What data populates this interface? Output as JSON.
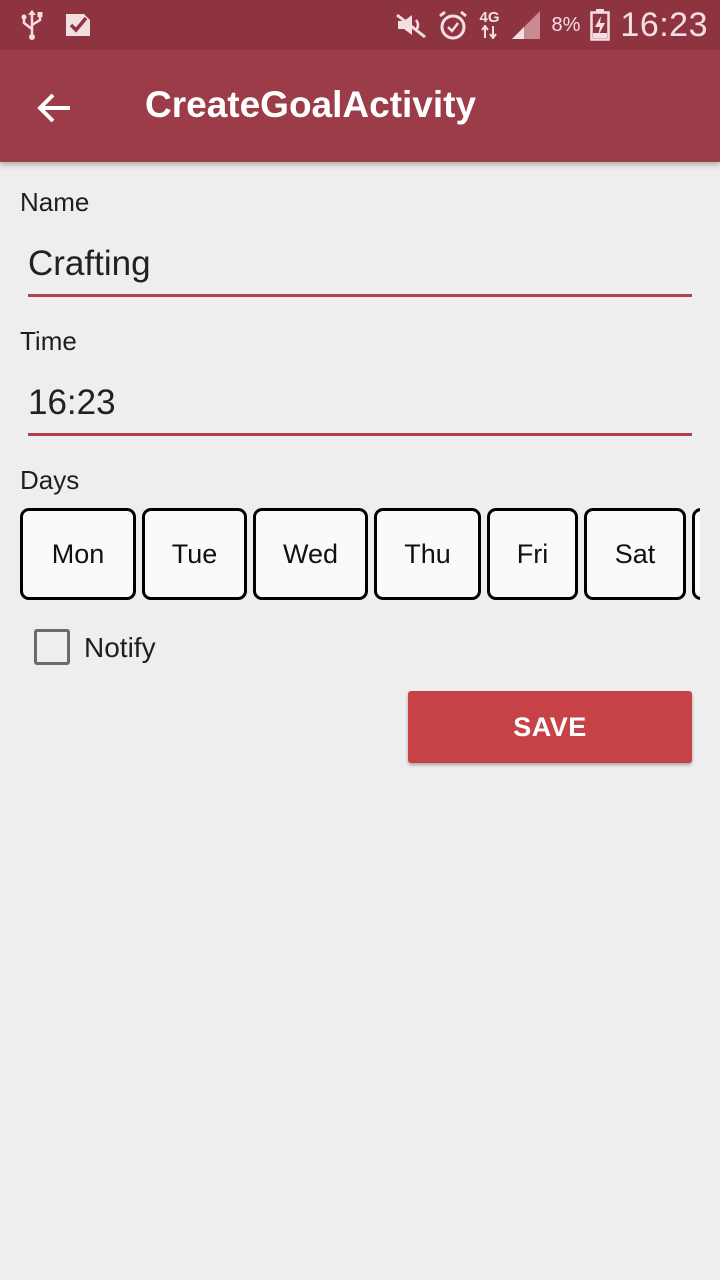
{
  "status_bar": {
    "network": "4G",
    "battery": "8%",
    "time": "16:23",
    "icons": [
      "usb-icon",
      "checklist-notification-icon",
      "mute-icon",
      "alarm-icon",
      "data-arrows-icon",
      "signal-icon",
      "battery-charging-icon"
    ]
  },
  "app_bar": {
    "title": "CreateGoalActivity",
    "back_icon": "arrow-back-icon"
  },
  "form": {
    "name_label": "Name",
    "name_value": "Crafting",
    "time_label": "Time",
    "time_value": "16:23",
    "days_label": "Days",
    "days": [
      "Mon",
      "Tue",
      "Wed",
      "Thu",
      "Fri",
      "Sat"
    ],
    "notify_label": "Notify",
    "notify_checked": false,
    "save_label": "SAVE"
  },
  "colors": {
    "status_bar": "#8e3440",
    "app_bar": "#9b3c48",
    "accent": "#b0424c",
    "save_button": "#c64246",
    "background": "#eeeeee"
  }
}
